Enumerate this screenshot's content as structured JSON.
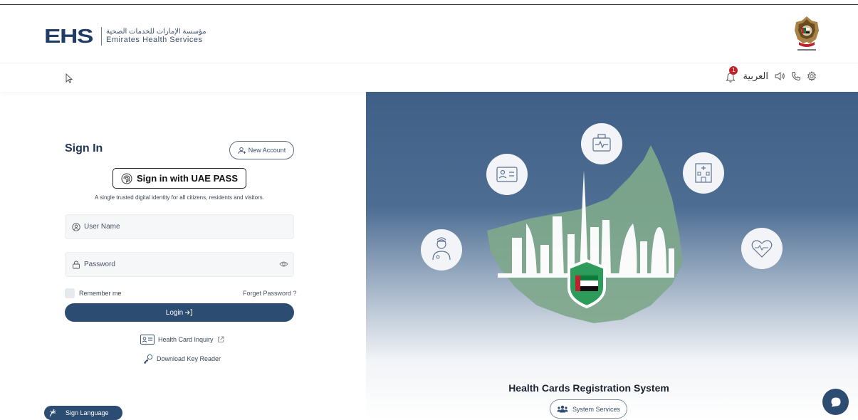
{
  "header": {
    "logo_mark": "EHS",
    "logo_arabic": "مؤسسة الإمارات للخدمات الصحية",
    "logo_english": "Emirates Health Services",
    "emblem_icon": "uae-emblem-icon"
  },
  "toolbar": {
    "notification_count": "1",
    "language_label": "العربية",
    "icons": [
      "bell-icon",
      "sound-icon",
      "phone-icon",
      "settings-icon"
    ]
  },
  "signin": {
    "title": "Sign In",
    "new_account_label": "New Account",
    "uaepass_label": "Sign in with UAE PASS",
    "uaepass_subtitle": "A single trusted digital identity for all citizens, residents and visitors.",
    "username_placeholder": "User Name",
    "password_placeholder": "Password",
    "remember_label": "Remember me",
    "forget_label": "Forget Password ?",
    "login_label": "Login"
  },
  "links": {
    "health_card_inquiry": "Health Card Inquiry",
    "download_key_reader": "Download Key Reader"
  },
  "accessibility": {
    "sign_language_label": "Sign Language"
  },
  "hero": {
    "title": "Health Cards Registration System",
    "services_label": "System Services",
    "feature_icons": [
      "id-card-icon",
      "medical-kit-icon",
      "hospital-icon",
      "doctor-icon",
      "heart-icon"
    ]
  },
  "colors": {
    "primary": "#2c4c72",
    "hero_top": "#3f5f86",
    "badge": "#c0222a",
    "map_green": "#7fa88c"
  }
}
